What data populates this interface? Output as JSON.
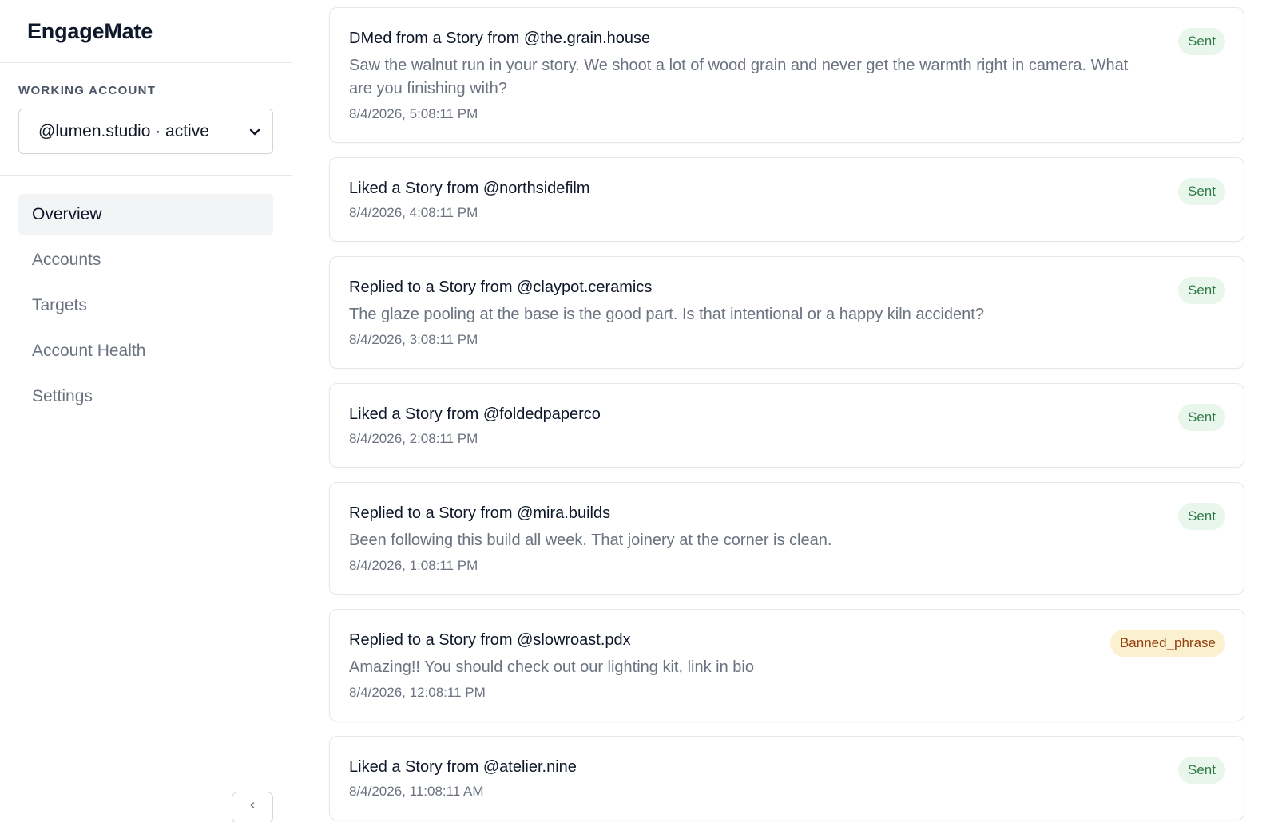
{
  "app": {
    "name": "EngageMate"
  },
  "sidebar": {
    "account_label": "Working Account",
    "account_value": "@lumen.studio · active",
    "nav": [
      {
        "label": "Overview",
        "active": true
      },
      {
        "label": "Accounts",
        "active": false
      },
      {
        "label": "Targets",
        "active": false
      },
      {
        "label": "Account Health",
        "active": false
      },
      {
        "label": "Settings",
        "active": false
      }
    ]
  },
  "activity": [
    {
      "title": "DMed from a Story from @the.grain.house",
      "body": "Saw the walnut run in your story. We shoot a lot of wood grain and never get the warmth right in camera. What are you finishing with?",
      "time": "8/4/2026, 5:08:11 PM",
      "status": "Sent"
    },
    {
      "title": "Liked a Story from @northsidefilm",
      "body": "",
      "time": "8/4/2026, 4:08:11 PM",
      "status": "Sent"
    },
    {
      "title": "Replied to a Story from @claypot.ceramics",
      "body": "The glaze pooling at the base is the good part. Is that intentional or a happy kiln accident?",
      "time": "8/4/2026, 3:08:11 PM",
      "status": "Sent"
    },
    {
      "title": "Liked a Story from @foldedpaperco",
      "body": "",
      "time": "8/4/2026, 2:08:11 PM",
      "status": "Sent"
    },
    {
      "title": "Replied to a Story from @mira.builds",
      "body": "Been following this build all week. That joinery at the corner is clean.",
      "time": "8/4/2026, 1:08:11 PM",
      "status": "Sent"
    },
    {
      "title": "Replied to a Story from @slowroast.pdx",
      "body": "Amazing!! You should check out our lighting kit, link in bio",
      "time": "8/4/2026, 12:08:11 PM",
      "status": "Banned_phrase"
    },
    {
      "title": "Liked a Story from @atelier.nine",
      "body": "",
      "time": "8/4/2026, 11:08:11 AM",
      "status": "Sent"
    }
  ],
  "colors": {
    "sent_bg": "#e8f6ec",
    "sent_fg": "#2f7a46",
    "warn_bg": "#fbf0d0",
    "warn_fg": "#92400e"
  },
  "icons": {
    "account_select": "chevron-down-icon",
    "collapse": "chevron-left-icon"
  }
}
